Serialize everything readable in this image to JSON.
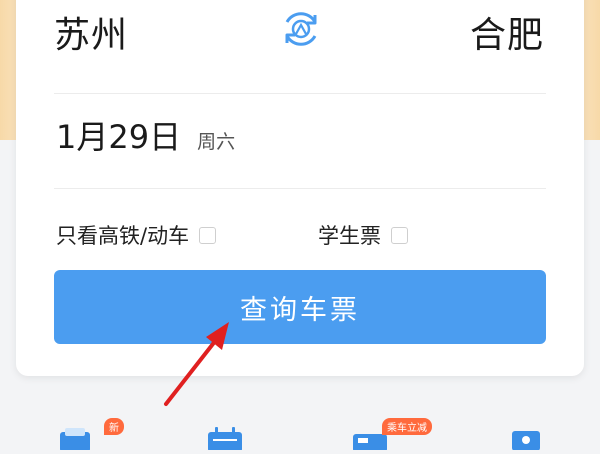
{
  "route": {
    "from_city": "苏州",
    "to_city": "合肥"
  },
  "date": {
    "value": "1月29日",
    "weekday": "周六"
  },
  "options": {
    "highspeed_label": "只看高铁/动车",
    "student_label": "学生票"
  },
  "search": {
    "button_label": "查询车票"
  },
  "bottom_nav": {
    "badge_new": "新",
    "badge_promo": "乘车立减"
  },
  "colors": {
    "primary": "#4b9df0",
    "arrow": "#e02020",
    "badge": "#ff6a3d"
  }
}
